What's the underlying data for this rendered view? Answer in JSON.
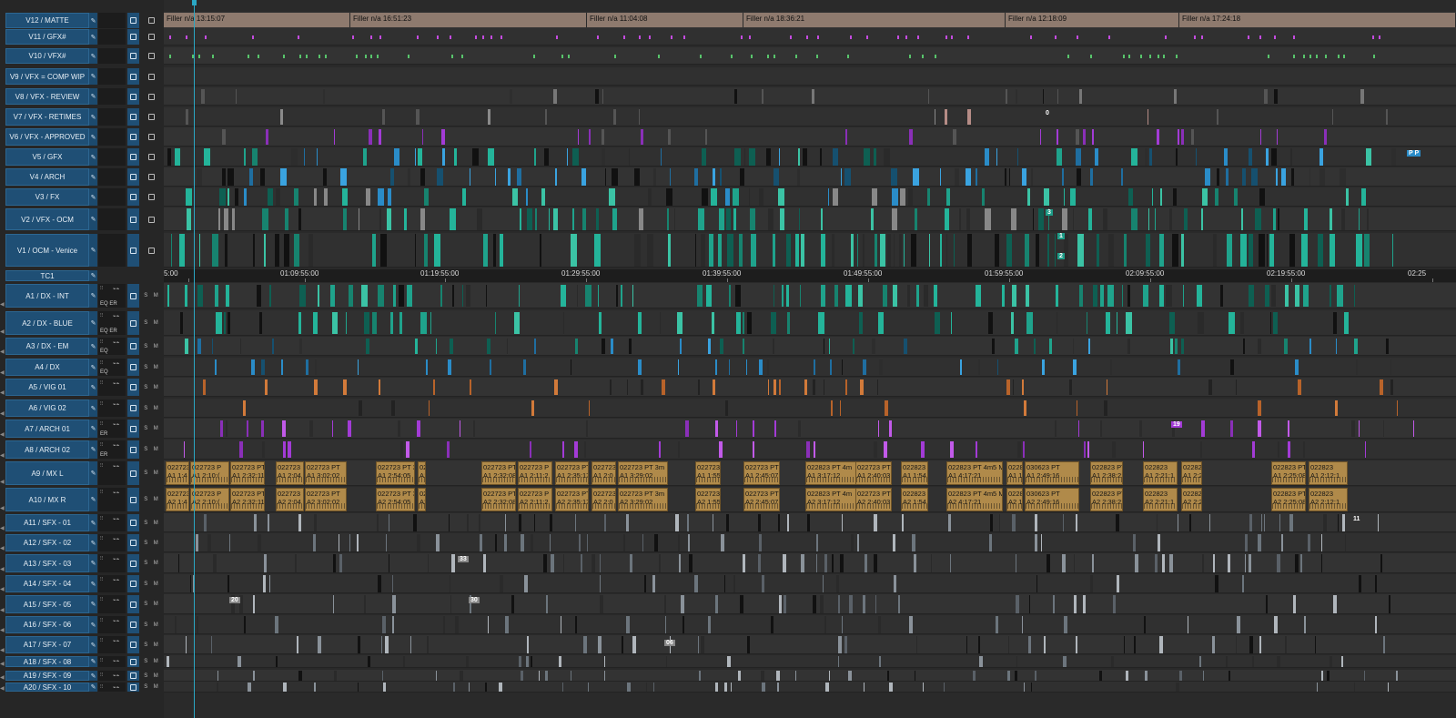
{
  "app": {
    "accent": "#1f4f75",
    "playhead_color": "#2aa7c4"
  },
  "video_tracks": [
    {
      "name": "V12 / MATTE"
    },
    {
      "name": "V11 / GFX#"
    },
    {
      "name": "V10 / VFX#"
    },
    {
      "name": "V9 / VFX = COMP WIP"
    },
    {
      "name": "V8 / VFX - REVIEW"
    },
    {
      "name": "V7 / VFX - RETIMES"
    },
    {
      "name": "V6 / VFX - APPROVED"
    },
    {
      "name": "V5 / GFX"
    },
    {
      "name": "V4 / ARCH"
    },
    {
      "name": "V3 / FX"
    },
    {
      "name": "V2 / VFX - OCM"
    },
    {
      "name": "V1 / OCM - Venice"
    }
  ],
  "timecode_track": {
    "name": "TC1"
  },
  "audio_tracks": [
    {
      "name": "A1 / DX - INT",
      "fx": "EQ ER"
    },
    {
      "name": "A2 / DX - BLUE",
      "fx": "EQ ER"
    },
    {
      "name": "A3 / DX - EM",
      "fx": "EQ"
    },
    {
      "name": "A4 / DX",
      "fx": "EQ"
    },
    {
      "name": "A5 / VIG 01",
      "fx": ""
    },
    {
      "name": "A6 / VIG 02",
      "fx": ""
    },
    {
      "name": "A7 / ARCH 01",
      "fx": "ER"
    },
    {
      "name": "A8 / ARCH 02",
      "fx": "ER"
    },
    {
      "name": "A9 / MX L",
      "fx": ""
    },
    {
      "name": "A10 / MX R",
      "fx": ""
    },
    {
      "name": "A11 / SFX - 01",
      "fx": ""
    },
    {
      "name": "A12 / SFX - 02",
      "fx": ""
    },
    {
      "name": "A13 / SFX - 03",
      "fx": ""
    },
    {
      "name": "A14 / SFX - 04",
      "fx": ""
    },
    {
      "name": "A15 / SFX - 05",
      "fx": ""
    },
    {
      "name": "A16 / SFX - 06",
      "fx": ""
    },
    {
      "name": "A17 / SFX - 07",
      "fx": ""
    },
    {
      "name": "A18 / SFX - 08",
      "fx": ""
    },
    {
      "name": "A19 / SFX - 09",
      "fx": ""
    },
    {
      "name": "A20 / SFX - 10",
      "fx": ""
    }
  ],
  "controls": {
    "solo": "S",
    "mute": "M"
  },
  "filler_clips": [
    {
      "label": "Filler n/a 13:15:07"
    },
    {
      "label": "Filler n/a 16:51:23"
    },
    {
      "label": "Filler n/a 11:04:08"
    },
    {
      "label": "Filler n/a 18:36:21"
    },
    {
      "label": "Filler n/a 12:18:09"
    },
    {
      "label": "Filler n/a 17:24:18"
    }
  ],
  "ruler_ticks": [
    {
      "label": "5:00"
    },
    {
      "label": "01:09:55:00"
    },
    {
      "label": "01:19:55:00"
    },
    {
      "label": "01:29:55:00"
    },
    {
      "label": "01:39:55:00"
    },
    {
      "label": "01:49:55:00"
    },
    {
      "label": "01:59:55:00"
    },
    {
      "label": "02:09:55:00"
    },
    {
      "label": "02:19:55:00"
    },
    {
      "label": "02:25"
    }
  ],
  "music_clips_L": [
    {
      "top": "022723",
      "bottom": "A1 1:4"
    },
    {
      "top": "022723 P",
      "bottom": "A1 2:10:("
    },
    {
      "top": "022723 PT",
      "bottom": "A1 2:32:11"
    },
    {
      "top": "022723",
      "bottom": "A1 2:04"
    },
    {
      "top": "022723 PT",
      "bottom": "A1 3:02:02"
    },
    {
      "top": "022723 PT 3",
      "bottom": "A1 2:54:05"
    },
    {
      "top": "022723 PT 3m",
      "bottom": "A1 3:17:21"
    },
    {
      "top": "022723 PT",
      "bottom": "A1 2:32:08"
    },
    {
      "top": "022723 P",
      "bottom": "A1 2:11:2"
    },
    {
      "top": "022723 PT",
      "bottom": "A1 2:35:17"
    },
    {
      "top": "022723",
      "bottom": "A1 2:0"
    },
    {
      "top": "022723 PT 3m",
      "bottom": "A1 3:29:02"
    },
    {
      "top": "022723",
      "bottom": "A1 1:55"
    },
    {
      "top": "022723 PT",
      "bottom": "A1 2:45:07"
    },
    {
      "top": "022823 PT 4m",
      "bottom": "A1 3:17:12"
    },
    {
      "top": "022723 PT",
      "bottom": "A1 2:40:03"
    },
    {
      "top": "022823",
      "bottom": "A1 1:54"
    },
    {
      "top": "022823 PT 4m5 M",
      "bottom": "A1 4:17:21"
    },
    {
      "top": "0228",
      "bottom": "A1 1:"
    },
    {
      "top": "030623 PT",
      "bottom": "A1 2:49:16"
    },
    {
      "top": "022823 PT",
      "bottom": "A1 2:38:21"
    },
    {
      "top": "022823",
      "bottom": "A1 2:21:1"
    },
    {
      "top": "022823",
      "bottom": "A1 2:28:13"
    },
    {
      "top": "022823 PT",
      "bottom": "A1 2:25:08"
    },
    {
      "top": "022823",
      "bottom": "A1 2:12:1"
    },
    {
      "top": "022823 PT 6m",
      "bottom": "A1 4:31:21"
    },
    {
      "top": "022823",
      "bottom": "A1 2:37:07"
    }
  ],
  "music_clips_R": [
    {
      "top": "022723",
      "bottom": "A2 1:4"
    },
    {
      "top": "022723 P",
      "bottom": "A2 2:10:("
    },
    {
      "top": "022723 PT",
      "bottom": "A2 2:32:11"
    },
    {
      "top": "022723",
      "bottom": "A2 2:04"
    },
    {
      "top": "022723 PT",
      "bottom": "A2 3:02:02"
    },
    {
      "top": "022723 PT 3",
      "bottom": "A2 2:54:05"
    },
    {
      "top": "022723 PT 3m",
      "bottom": "A2 3:17:21"
    },
    {
      "top": "022723 PT",
      "bottom": "A2 2:32:08"
    },
    {
      "top": "022723 P",
      "bottom": "A2 2:11:2"
    },
    {
      "top": "022723 PT",
      "bottom": "A2 2:35:17"
    },
    {
      "top": "022723",
      "bottom": "A2 2:0"
    },
    {
      "top": "022723 PT 3m",
      "bottom": "A2 3:29:02"
    },
    {
      "top": "022723",
      "bottom": "A2 1:55"
    },
    {
      "top": "022723 PT",
      "bottom": "A2 2:45:07"
    },
    {
      "top": "022823 PT 4m",
      "bottom": "A2 3:17:12"
    },
    {
      "top": "022723 PT",
      "bottom": "A2 2:40:03"
    },
    {
      "top": "022823",
      "bottom": "A2 1:54"
    },
    {
      "top": "022823 PT 4m5 M",
      "bottom": "A2 4:17:21"
    },
    {
      "top": "0228",
      "bottom": "A2 1:"
    },
    {
      "top": "030623 PT",
      "bottom": "A2 2:49:16"
    },
    {
      "top": "022823 PT",
      "bottom": "A2 2:38:21"
    },
    {
      "top": "022823",
      "bottom": "A2 2:21:1"
    },
    {
      "top": "022823",
      "bottom": "A2 2:28:13"
    },
    {
      "top": "022823 PT",
      "bottom": "A2 2:25:08"
    },
    {
      "top": "022823",
      "bottom": "A2 2:12:1"
    },
    {
      "top": "022823 PT 6m",
      "bottom": "A2 4:31:21"
    },
    {
      "top": "022823",
      "bottom": "A2 2:37:07"
    }
  ],
  "clip_numbers": {
    "n1": "1",
    "n2": "2",
    "n3": "3",
    "n4": "0",
    "n5": "06",
    "n6": "19",
    "n7": "11",
    "n8": "33",
    "n9": "30",
    "n10": "20",
    "n11": "P P"
  }
}
